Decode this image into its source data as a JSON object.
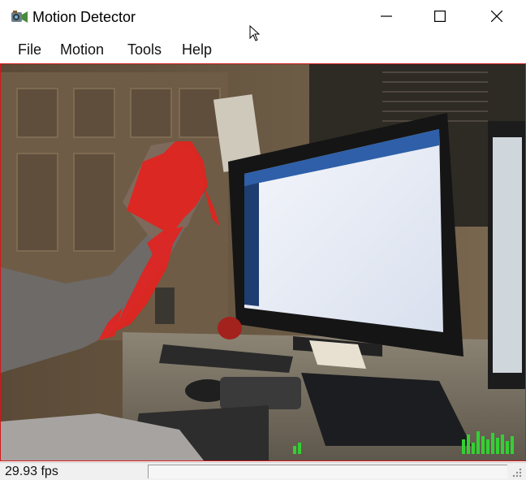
{
  "window": {
    "title": "Motion Detector",
    "icon": "motion-detector-app-icon"
  },
  "controls": {
    "minimize_icon": "minimize-icon",
    "maximize_icon": "maximize-icon",
    "close_icon": "close-icon"
  },
  "menu": {
    "items": [
      {
        "label": "File"
      },
      {
        "label": "Motion"
      },
      {
        "label": "Tools"
      },
      {
        "label": "Help"
      }
    ]
  },
  "video": {
    "content": "webcam-feed-with-motion-highlight",
    "highlight_color": "#e8201c",
    "meter_color": "#33d033"
  },
  "status": {
    "fps": "29.93 fps"
  },
  "colors": {
    "frame_border": "#d01a1a",
    "background": "#ffffff"
  }
}
